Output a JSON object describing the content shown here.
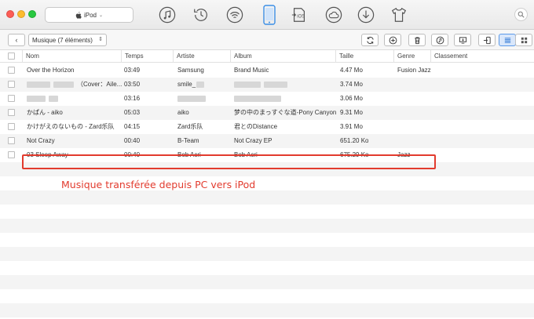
{
  "window": {
    "device_label": "iPod",
    "toolbar_icons": [
      "music-icon",
      "history-icon",
      "wifi-sync-icon",
      "phone-icon",
      "ios-transfer-icon",
      "cloud-icon",
      "download-icon",
      "shirt-icon"
    ],
    "ios_label": "iOS"
  },
  "subbar": {
    "category": "Musique (7 éléments)"
  },
  "columns": {
    "name": "Nom",
    "time": "Temps",
    "artist": "Artiste",
    "album": "Album",
    "size": "Taille",
    "genre": "Genre",
    "rating": "Classement"
  },
  "rows": [
    {
      "name": "Over the Horizon",
      "time": "03:49",
      "artist": "Samsung",
      "album": "Brand Music",
      "size": "4.47 Mo",
      "genre": "Fusion Jazz"
    },
    {
      "name": "（Cover：Aile...",
      "time": "03:50",
      "artist": "smile_",
      "album": "",
      "size": "3.74 Mo",
      "genre": ""
    },
    {
      "name": "",
      "time": "03:16",
      "artist": "",
      "album": "",
      "size": "3.06 Mo",
      "genre": ""
    },
    {
      "name": "かぱん - aiko",
      "time": "05:03",
      "artist": "aiko",
      "album": "梦の中のまっすぐな道-Pony Canyon",
      "size": "9.31 Mo",
      "genre": ""
    },
    {
      "name": "かけがえのないもの - Zard乐队",
      "time": "04:15",
      "artist": "Zard乐队",
      "album": "君とのDistance",
      "size": "3.91 Mo",
      "genre": ""
    },
    {
      "name": "Not Crazy",
      "time": "00:40",
      "artist": "B-Team",
      "album": "Not Crazy EP",
      "size": "651.20 Ko",
      "genre": ""
    },
    {
      "name": "03 Sleep Away",
      "time": "00:40",
      "artist": "Bob Acri",
      "album": "Bob Acri",
      "size": "675.29 Ko",
      "genre": "Jazz"
    }
  ],
  "annotation": "Musique transférée depuis PC vers iPod",
  "colors": {
    "highlight": "#e23b2e",
    "accent": "#5b9ae9"
  }
}
